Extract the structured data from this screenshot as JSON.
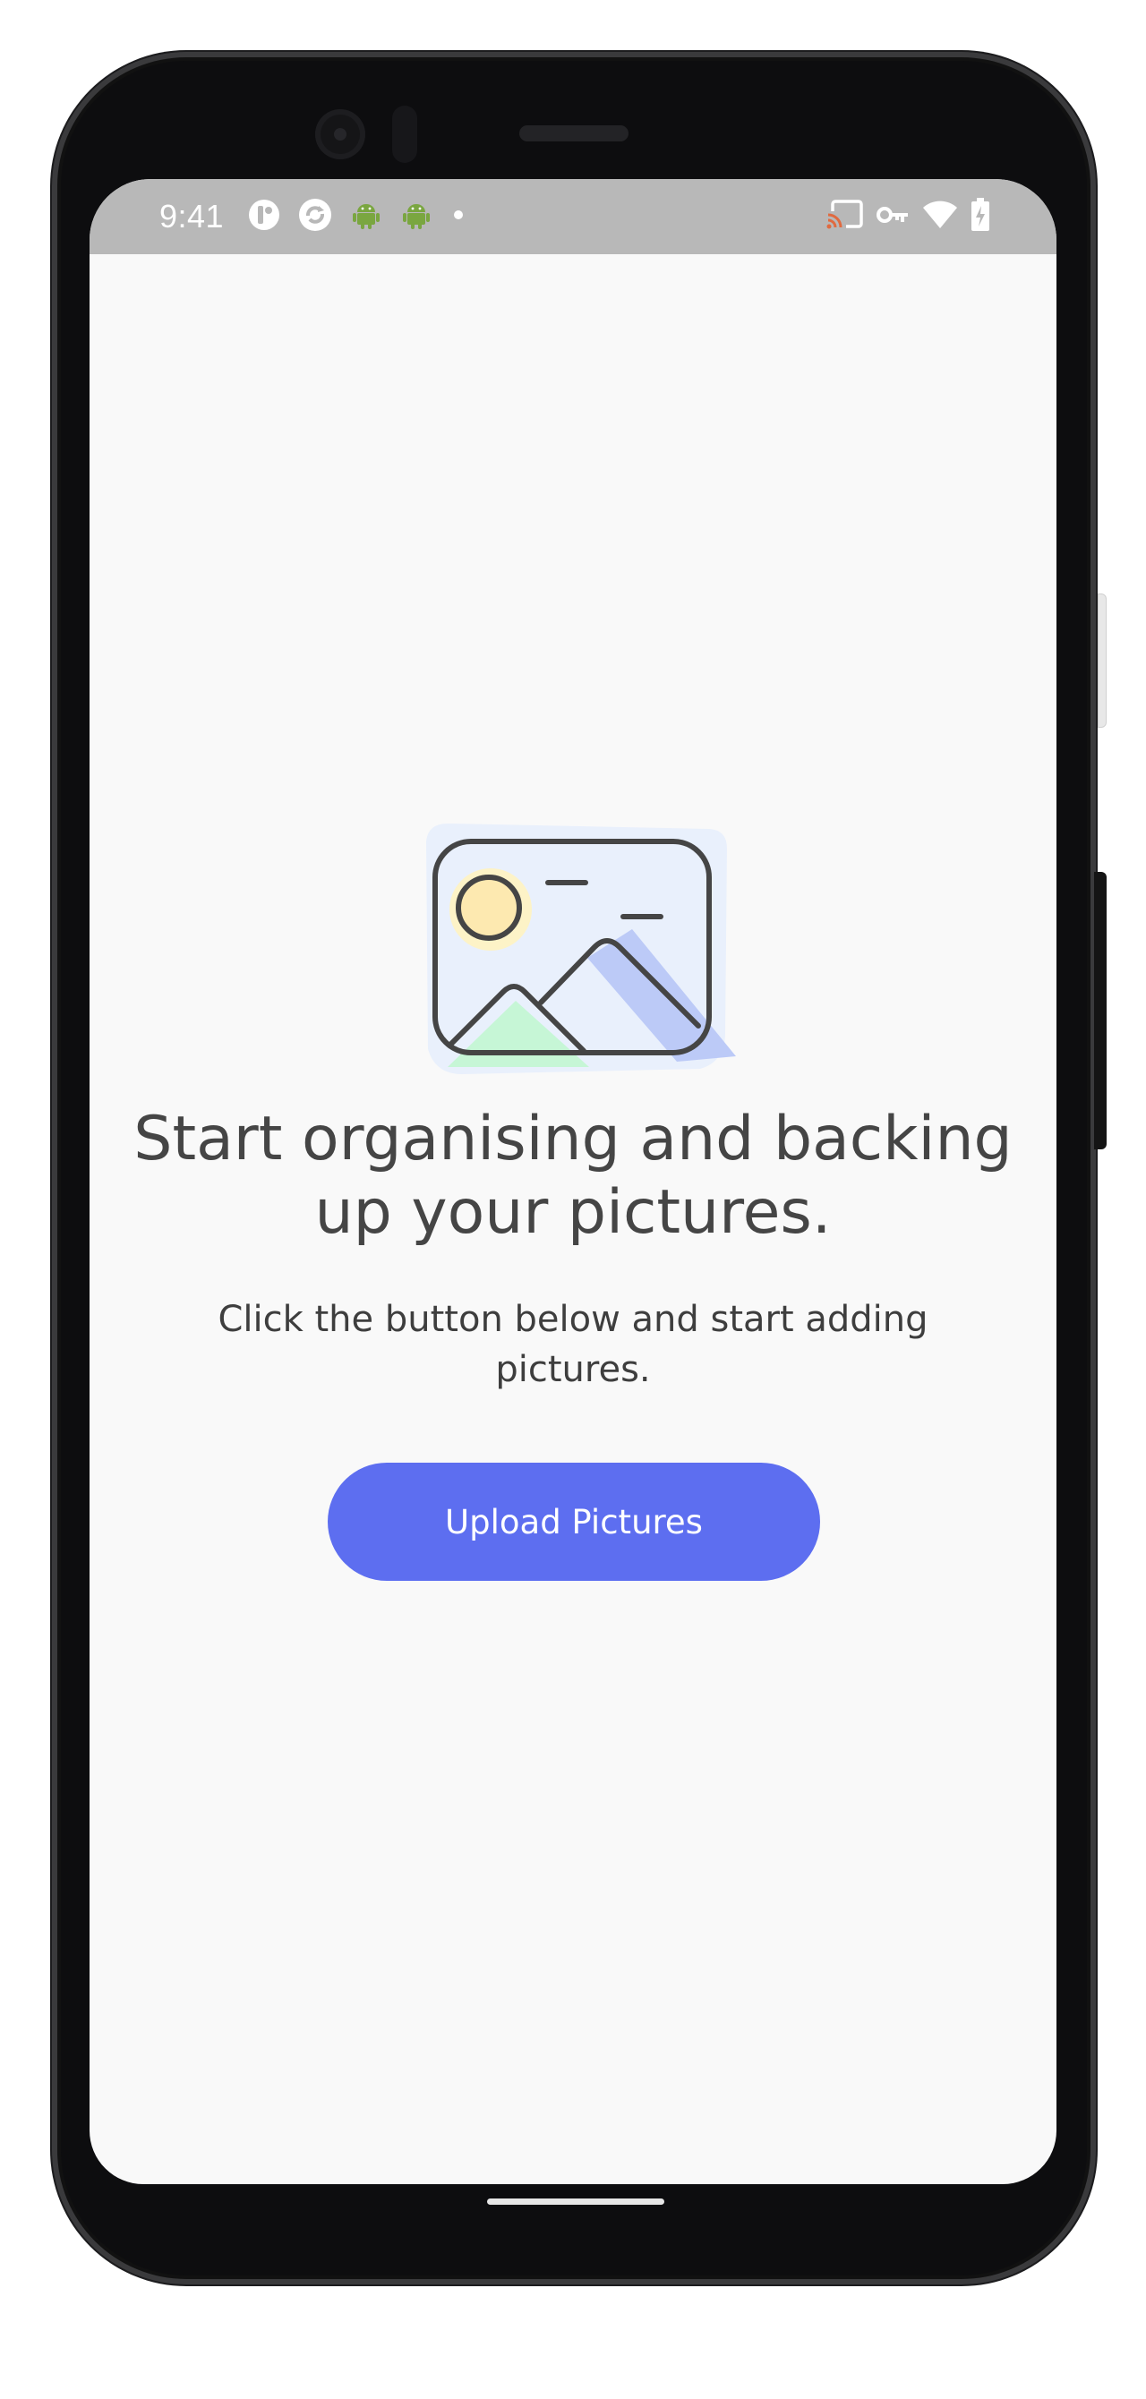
{
  "status_bar": {
    "time": "9:41",
    "left_icons": [
      "notification-app-icon",
      "sync-app-icon",
      "android-icon",
      "android-icon",
      "dot-icon"
    ],
    "right_icons": [
      "cast-icon",
      "vpn-key-icon",
      "wifi-icon",
      "battery-charging-icon"
    ]
  },
  "main": {
    "headline": "Start organising and backing up your pictures.",
    "subtext": "Click the button below and start adding pictures.",
    "upload_button_label": "Upload Pictures"
  },
  "colors": {
    "accent": "#5d6ef0",
    "background": "#f9f9f9",
    "status_bar": "#b8b8b8",
    "text": "#454545"
  }
}
